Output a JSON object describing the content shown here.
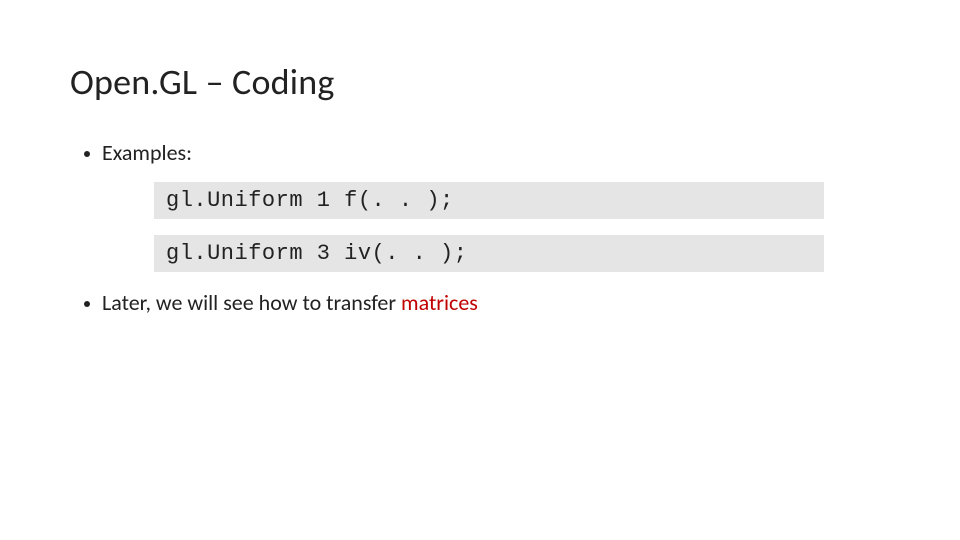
{
  "slide": {
    "title": "Open.GL – Coding",
    "bullets": {
      "examples": "Examples:",
      "later_prefix": "Later, we will see how to transfer ",
      "later_accent": "matrices"
    },
    "code": {
      "line1": "gl.Uniform 1 f(. . );",
      "line2": "gl.Uniform 3 iv(. . );"
    }
  }
}
